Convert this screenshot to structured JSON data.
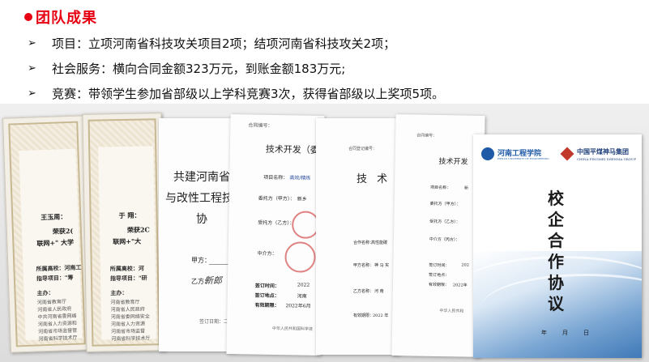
{
  "header": {
    "title": "团队成果"
  },
  "bullets": [
    {
      "arrow": "➢",
      "text": "项目：立项河南省科技攻关项目2项；结项河南省科技攻关2项；"
    },
    {
      "arrow": "➢",
      "text": "社会服务：横向合同金额323万元，到账金额183万元;"
    },
    {
      "arrow": "➢",
      "text": "竞赛：带领学生参加省部级以上学科竞赛3次，获得省部级以上奖项5项。"
    }
  ],
  "certificates": [
    {
      "name": "王玉周：",
      "line1": "荣获2(",
      "line2": "联网+\" 大学",
      "school": "所属高校：河南工",
      "advisor": "指导项目：\"筹",
      "org_label": "主办：",
      "orgs": [
        "河南省教育厅",
        "河南省人民政府",
        "中共河南省委网络",
        "河南省人力资源和",
        "河南省市场监督管",
        "河南省科学技术厅"
      ]
    },
    {
      "name": "于 翔：",
      "line1": "荣获2C",
      "line2": "联网+\"大",
      "school": "所属高校：河",
      "advisor": "指导项目：\"研",
      "org_label": "主办：",
      "orgs": [
        "河南省教育厅",
        "河南省人民政府",
        "河南省委网络安全",
        "河南省人力资源",
        "河南省市场监督",
        "河南省科学技术厅"
      ]
    }
  ],
  "docs": {
    "doc3": {
      "title1": "共建河南省",
      "title2": "与改性工程技",
      "title3": "协　议",
      "party_a": "甲方：",
      "party_b": "乙方：",
      "signature": "新郎",
      "footer": "签订日期：二"
    },
    "doc4": {
      "header": "合同编号：",
      "title": "技术开发（委",
      "project": "项目名称：",
      "project_val": "高效/精炼",
      "client": "委托方（甲方）：",
      "client_val": "新乡",
      "dev": "受托方（乙方）：",
      "mid": "中介方：",
      "sign_time": "签订时间：",
      "sign_time_val": "2022",
      "sign_place": "签订地点：",
      "sign_place_val": "河南",
      "valid": "有效期限：",
      "valid_val": "2022年6月",
      "footer": "中华人民共和国科学技"
    },
    "doc5": {
      "header": "合同登记编号：",
      "title": "技 术 合",
      "project": "合作名称：",
      "project_val": "高性能碳",
      "party_a": "甲方名称：",
      "party_a_val": "神 马 实",
      "party_b": "乙方名称：",
      "party_b_val": "河 南",
      "valid": "有效期限：",
      "valid_val": "2022 年"
    },
    "doc6": {
      "header": "合同编号：",
      "title": "技术开发",
      "project": "项目名称：",
      "project_val": "新",
      "client": "委托方（甲方）：",
      "dev": "受托方（乙方）：",
      "mid": "中介方（丙方）：",
      "sign_time": "签订时间：",
      "sign_time_val": "202",
      "sign_place": "签订地点：",
      "valid": "有效期限：",
      "valid_val": "2022年",
      "footer": "中华人民共和"
    },
    "doc7": {
      "school_logo": "河南工程学院",
      "school_sub": "HENAN UNIVERSITY OF ENGINEERING",
      "group_name": "中国平煤神马集团",
      "group_sub": "CHINA PINGMEI SHENMA GROUP",
      "title": "校企合作协议",
      "date_label": "年　月　日"
    }
  },
  "colors": {
    "accent": "#e60012",
    "cover_blue": "#3f79b8"
  }
}
